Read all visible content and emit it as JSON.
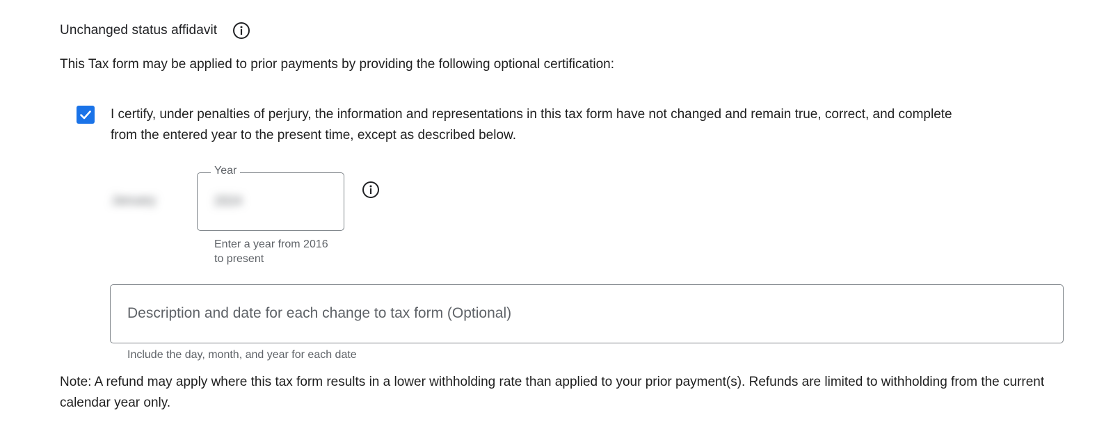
{
  "section": {
    "title": "Unchanged status affidavit",
    "info_icon": "info-circle-icon"
  },
  "intro_text": "This Tax form may be applied to prior payments by providing the following optional certification:",
  "certification": {
    "checked": true,
    "text": "I certify, under penalties of perjury, the information and representations in this tax form have not changed and remain true, correct, and complete from the entered year to the present time, except as described below."
  },
  "month_field": {
    "value": "January"
  },
  "year_field": {
    "label": "Year",
    "value": "2024",
    "hint": "Enter a year from 2016 to present",
    "info_icon": "info-circle-icon"
  },
  "description_field": {
    "placeholder": "Description and date for each change to tax form (Optional)",
    "hint": "Include the day, month, and year for each date"
  },
  "note": "Note: A refund may apply where this tax form results in a lower withholding rate than applied to your prior payment(s). Refunds are limited to withholding from the current calendar year only.",
  "colors": {
    "accent": "#1a73e8",
    "text": "#1f1f1f",
    "secondary_text": "#5f6368",
    "border": "#80868b"
  }
}
